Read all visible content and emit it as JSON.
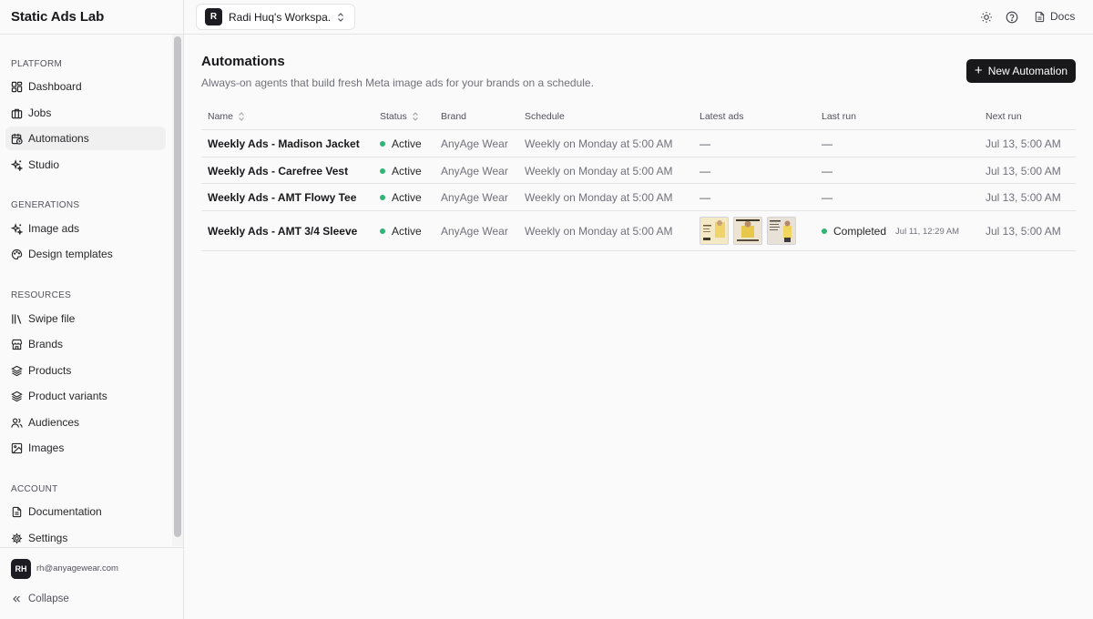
{
  "app": {
    "title": "Static Ads Lab"
  },
  "workspace": {
    "badge": "R",
    "name": "Radi Huq's Workspa..."
  },
  "topbar": {
    "docs_label": "Docs",
    "theme_icon": "sun-icon",
    "help_icon": "help-circle-icon"
  },
  "sidebar": {
    "sections": [
      {
        "label": "PLATFORM",
        "items": [
          {
            "label": "Dashboard",
            "icon": "dashboard-icon",
            "active": false
          },
          {
            "label": "Jobs",
            "icon": "briefcase-icon",
            "active": false
          },
          {
            "label": "Automations",
            "icon": "calendar-clock-icon",
            "active": true
          },
          {
            "label": "Studio",
            "icon": "sparkles-icon",
            "active": false
          }
        ]
      },
      {
        "label": "GENERATIONS",
        "items": [
          {
            "label": "Image ads",
            "icon": "sparkles-icon",
            "active": false
          },
          {
            "label": "Design templates",
            "icon": "palette-icon",
            "active": false
          }
        ]
      },
      {
        "label": "RESOURCES",
        "items": [
          {
            "label": "Swipe file",
            "icon": "library-icon",
            "active": false
          },
          {
            "label": "Brands",
            "icon": "store-icon",
            "active": false
          },
          {
            "label": "Products",
            "icon": "layers-icon",
            "active": false
          },
          {
            "label": "Product variants",
            "icon": "layers-icon",
            "active": false
          },
          {
            "label": "Audiences",
            "icon": "users-icon",
            "active": false
          },
          {
            "label": "Images",
            "icon": "image-icon",
            "active": false
          }
        ]
      },
      {
        "label": "ACCOUNT",
        "items": [
          {
            "label": "Documentation",
            "icon": "file-text-icon",
            "active": false
          },
          {
            "label": "Settings",
            "icon": "gear-icon",
            "active": false
          }
        ]
      }
    ],
    "user": {
      "initials": "RH",
      "email": "rh@anyagewear.com"
    },
    "collapse_label": "Collapse"
  },
  "main": {
    "title": "Automations",
    "subtitle": "Always-on agents that build fresh Meta image ads for your brands on a schedule.",
    "new_button_label": "New Automation"
  },
  "table": {
    "columns": {
      "name": "Name",
      "status": "Status",
      "brand": "Brand",
      "schedule": "Schedule",
      "latest_ads": "Latest ads",
      "last_run": "Last run",
      "next_run": "Next run"
    },
    "rows": [
      {
        "name": "Weekly Ads - Madison Jacket",
        "status": "Active",
        "brand": "AnyAge Wear",
        "schedule": "Weekly on Monday at 5:00 AM",
        "latest_ads": "—",
        "last_run": "—",
        "last_run_time": "",
        "next_run": "Jul 13, 5:00 AM"
      },
      {
        "name": "Weekly Ads - Carefree Vest",
        "status": "Active",
        "brand": "AnyAge Wear",
        "schedule": "Weekly on Monday at 5:00 AM",
        "latest_ads": "—",
        "last_run": "—",
        "last_run_time": "",
        "next_run": "Jul 13, 5:00 AM"
      },
      {
        "name": "Weekly Ads - AMT Flowy Tee",
        "status": "Active",
        "brand": "AnyAge Wear",
        "schedule": "Weekly on Monday at 5:00 AM",
        "latest_ads": "—",
        "last_run": "—",
        "last_run_time": "",
        "next_run": "Jul 13, 5:00 AM"
      },
      {
        "name": "Weekly Ads - AMT 3/4 Sleeve",
        "status": "Active",
        "brand": "AnyAge Wear",
        "schedule": "Weekly on Monday at 5:00 AM",
        "latest_ads": "",
        "last_run": "Completed",
        "last_run_time": "Jul 11, 12:29 AM",
        "next_run": "Jul 13, 5:00 AM"
      }
    ]
  },
  "colors": {
    "accent": "#18181b",
    "active_dot": "#2fb574",
    "border": "#e4e4e7"
  }
}
